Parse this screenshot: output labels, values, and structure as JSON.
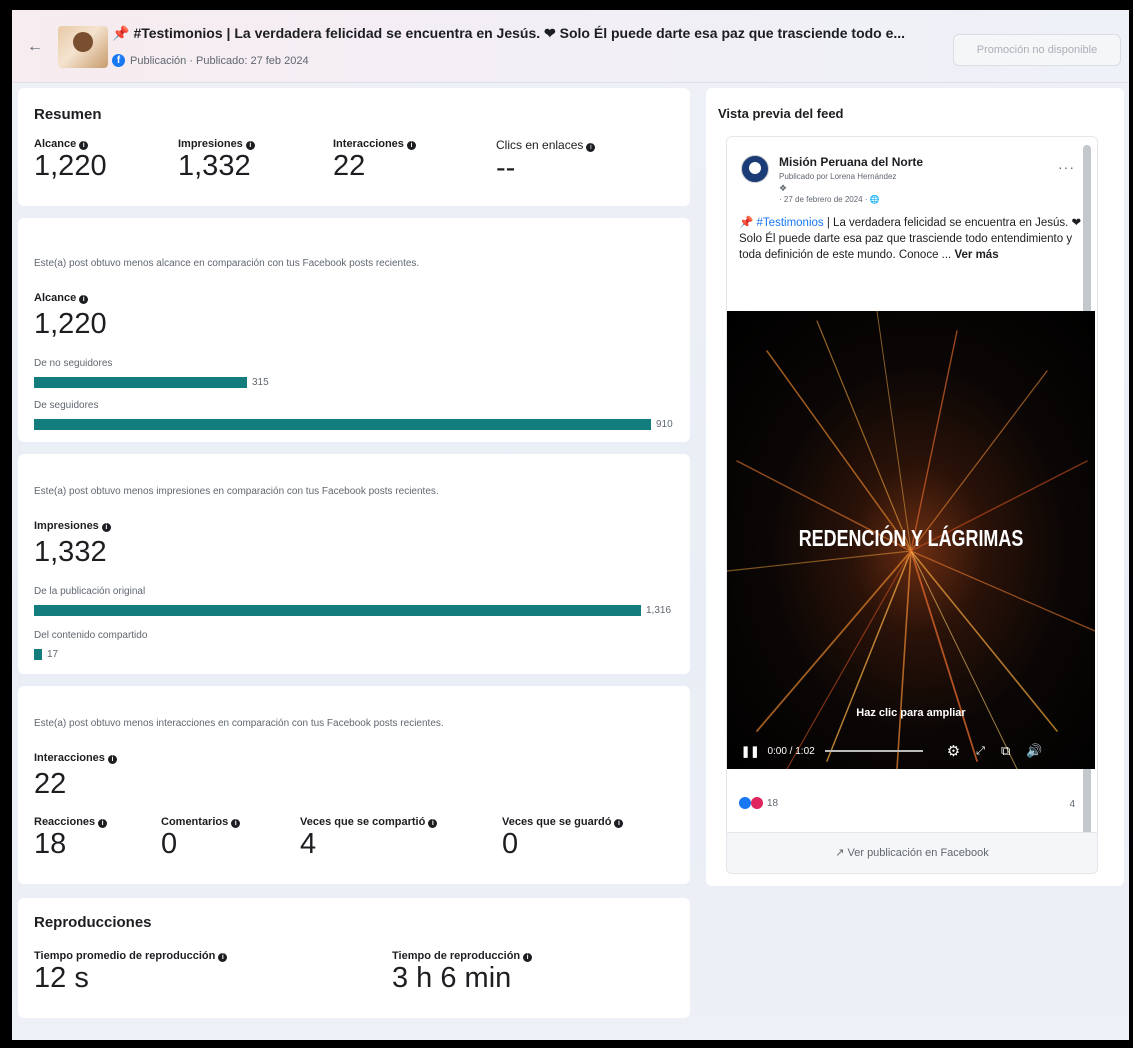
{
  "header": {
    "title": "#Testimonios | La verdadera felicidad se encuentra en Jesús. ❤ Solo Él puede darte esa paz que trasciende todo e...",
    "subtitle": "Publicación · Publicado: 27 feb 2024",
    "promo_button": "Promoción no disponible"
  },
  "summary": {
    "title": "Resumen",
    "metrics": [
      {
        "label": "Alcance",
        "value": "1,220"
      },
      {
        "label": "Impresiones",
        "value": "1,332"
      },
      {
        "label": "Interacciones",
        "value": "22"
      },
      {
        "label": "Clics en enlaces",
        "value": "--"
      }
    ]
  },
  "reach": {
    "note": "Este(a) post obtuvo menos alcance en comparación con tus Facebook posts recientes.",
    "label": "Alcance",
    "value": "1,220",
    "bars": [
      {
        "label": "De no seguidores",
        "value": "315",
        "fraction": 0.346
      },
      {
        "label": "De seguidores",
        "value": "910",
        "fraction": 1.0
      }
    ]
  },
  "impressions": {
    "note": "Este(a) post obtuvo menos impresiones en comparación con tus Facebook posts recientes.",
    "label": "Impresiones",
    "value": "1,332",
    "bars": [
      {
        "label": "De la publicación original",
        "value": "1,316",
        "fraction": 1.0
      },
      {
        "label": "Del contenido compartido",
        "value": "17",
        "fraction": 0.013
      }
    ]
  },
  "interactions": {
    "note": "Este(a) post obtuvo menos interacciones en comparación con tus Facebook posts recientes.",
    "label": "Interacciones",
    "value": "22",
    "items": [
      {
        "label": "Reacciones",
        "value": "18"
      },
      {
        "label": "Comentarios",
        "value": "0"
      },
      {
        "label": "Veces que se compartió",
        "value": "4"
      },
      {
        "label": "Veces que se guardó",
        "value": "0"
      }
    ]
  },
  "plays": {
    "title": "Reproducciones",
    "items": [
      {
        "label": "Tiempo promedio de reproducción",
        "value": "12 s"
      },
      {
        "label": "Tiempo de reproducción",
        "value": "3 h 6 min"
      }
    ]
  },
  "preview": {
    "title": "Vista previa del feed",
    "page_name": "Misión Peruana del Norte",
    "published_by": "Publicado por Lorena Hernández",
    "date": "27 de febrero de 2024",
    "text_hashtag": "#Testimonios",
    "text_body": "| La verdadera felicidad se encuentra en Jesús. ❤ Solo Él puede darte esa paz que trasciende todo entendimiento y toda definición de este mundo. Conoce ...",
    "see_more": "Ver más",
    "video_title": "REDENCIÓN Y LÁGRIMAS",
    "enlarge_hint": "Haz clic para ampliar",
    "time": "0:00 / 1:02",
    "reactions_count": "18",
    "shares_count": "4",
    "view_link": "Ver publicación en Facebook"
  },
  "colors": {
    "bar": "#137c7d",
    "link": "#1877f2",
    "heart": "#e0245e"
  }
}
